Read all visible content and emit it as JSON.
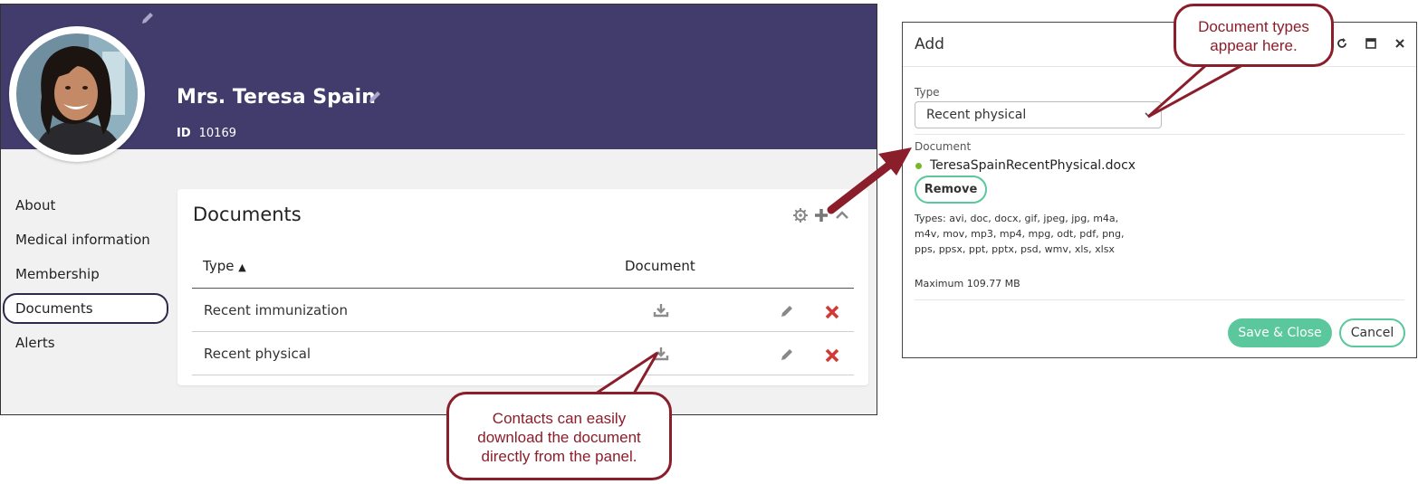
{
  "profile": {
    "name": "Mrs. Teresa Spain",
    "id_label": "ID",
    "id_value": "10169"
  },
  "nav": {
    "items": [
      {
        "label": "About"
      },
      {
        "label": "Medical information"
      },
      {
        "label": "Membership"
      },
      {
        "label": "Documents",
        "active": true
      },
      {
        "label": "Alerts"
      }
    ]
  },
  "documents_card": {
    "title": "Documents",
    "columns": {
      "type": "Type",
      "document": "Document"
    },
    "sort_indicator": "▲",
    "rows": [
      {
        "type": "Recent immunization"
      },
      {
        "type": "Recent physical"
      }
    ]
  },
  "add_dialog": {
    "title": "Add",
    "type_label": "Type",
    "type_value": "Recent physical",
    "document_label": "Document",
    "file_name": "TeresaSpainRecentPhysical.docx",
    "remove_label": "Remove",
    "types_text": "Types: avi, doc, docx, gif, jpeg, jpg, m4a, m4v, mov, mp3, mp4, mpg, odt, pdf, png, pps, ppsx, ppt, pptx, psd, wmv, xls, xlsx",
    "max_text": "Maximum 109.77 MB",
    "save_label": "Save & Close",
    "cancel_label": "Cancel"
  },
  "callouts": {
    "types_line1": "Document types",
    "types_line2": "appear here.",
    "download_line1": "Contacts can easily",
    "download_line2": "download the document",
    "download_line3": "directly from the panel."
  },
  "colors": {
    "header_band": "#423c6d",
    "accent_green": "#5bc79c",
    "delete_red": "#d23a3a",
    "callout_red": "#8b1e2b"
  }
}
